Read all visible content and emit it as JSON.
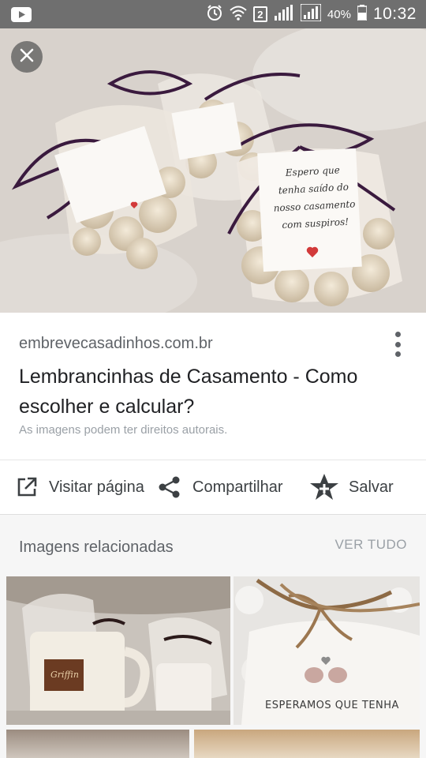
{
  "status_bar": {
    "sim": "2",
    "battery": "40%",
    "time": "10:32"
  },
  "hero": {
    "tag_text": [
      "Espero que",
      "tenha saído do",
      "nosso casamento",
      "com suspiros!"
    ]
  },
  "result": {
    "domain": "embrevecasadinhos.com.br",
    "title": "Lembrancinhas de Casamento - Como escolher e calcular?",
    "copyright": "As imagens podem ter direitos autorais."
  },
  "actions": {
    "visit_label": "Visitar página",
    "share_label": "Compartilhar",
    "save_label": "Salvar"
  },
  "related": {
    "title": "Imagens relacionadas",
    "see_all": "VER TUDO",
    "thumb1_brand": "Griffin",
    "thumb2_caption": "ESPERAMOS QUE TENHA"
  },
  "colors": {
    "status_bar": "#6f6f6f",
    "text_primary": "#202124",
    "text_secondary": "#5f6368",
    "text_muted": "#9aa0a6",
    "ribbon": "#3a1a3e"
  }
}
